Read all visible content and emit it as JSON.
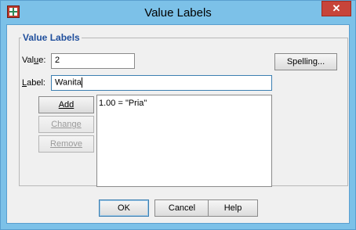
{
  "window": {
    "title": "Value Labels",
    "close_glyph": "✕"
  },
  "group": {
    "title": "Value Labels"
  },
  "value_field": {
    "label": "Value:",
    "accel": "u",
    "value": "2"
  },
  "label_field": {
    "label": "Label:",
    "accel": "L",
    "value": "Wanita"
  },
  "buttons": {
    "spelling": "Spelling...",
    "add": "Add",
    "change": "Change",
    "remove": "Remove",
    "ok": "OK",
    "cancel": "Cancel",
    "help": "Help"
  },
  "value_list": {
    "items": [
      "1.00 = \"Pria\""
    ]
  },
  "colors": {
    "titlebar": "#7cc1e8",
    "close": "#c7443a",
    "group_title": "#1f4e9c",
    "dialog_bg": "#f0f0f0"
  }
}
